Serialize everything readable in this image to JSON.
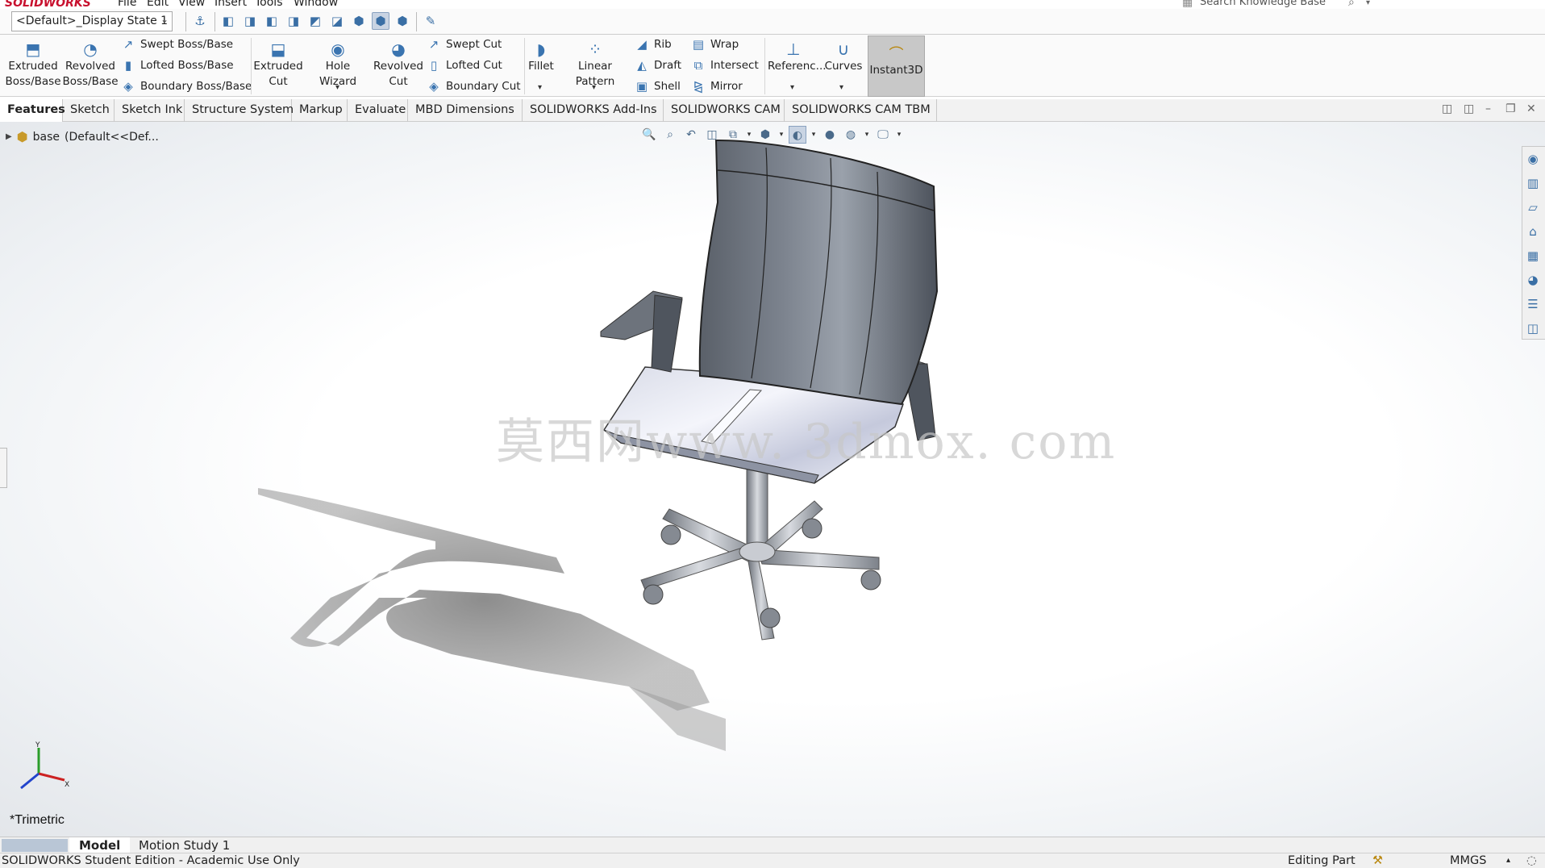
{
  "app": {
    "logo": "SOLIDWORKS"
  },
  "menu": [
    "File",
    "Edit",
    "View",
    "Insert",
    "Tools",
    "Window"
  ],
  "search": {
    "placeholder": "Search Knowledge Base"
  },
  "display_state": "<Default>_Display State 1",
  "ribbon": {
    "extruded_boss": [
      "Extruded",
      "Boss/Base"
    ],
    "revolved_boss": [
      "Revolved",
      "Boss/Base"
    ],
    "swept_boss": "Swept Boss/Base",
    "lofted_boss": "Lofted Boss/Base",
    "boundary_boss": "Boundary Boss/Base",
    "extruded_cut": [
      "Extruded",
      "Cut"
    ],
    "hole_wizard": "Hole Wizard",
    "revolved_cut": [
      "Revolved",
      "Cut"
    ],
    "swept_cut": "Swept Cut",
    "lofted_cut": "Lofted Cut",
    "boundary_cut": "Boundary Cut",
    "fillet": "Fillet",
    "linear_pattern": "Linear Pattern",
    "rib": "Rib",
    "draft": "Draft",
    "shell": "Shell",
    "wrap": "Wrap",
    "intersect": "Intersect",
    "mirror": "Mirror",
    "reference": "Referenc...",
    "curves": "Curves",
    "instant3d": "Instant3D"
  },
  "tabs": [
    "Features",
    "Sketch",
    "Sketch Ink",
    "Structure System",
    "Markup",
    "Evaluate",
    "MBD Dimensions",
    "SOLIDWORKS Add-Ins",
    "SOLIDWORKS CAM",
    "SOLIDWORKS CAM TBM"
  ],
  "tree": {
    "root": "base",
    "config": "(Default<<Def..."
  },
  "watermark": "莫西网www. 3dmox. com",
  "triad": {
    "x": "X",
    "y": "Y"
  },
  "view_name": "*Trimetric",
  "bottom_tabs": [
    "Model",
    "Motion Study 1"
  ],
  "status": {
    "left": "SOLIDWORKS Student Edition - Academic Use Only",
    "mode": "Editing Part",
    "units": "MMGS"
  },
  "colors": {
    "accent": "#3a74b0",
    "ribbon_bg": "#fafafa",
    "tab_active": "#ffffff",
    "instant3d_bg": "#c8c8c8"
  }
}
